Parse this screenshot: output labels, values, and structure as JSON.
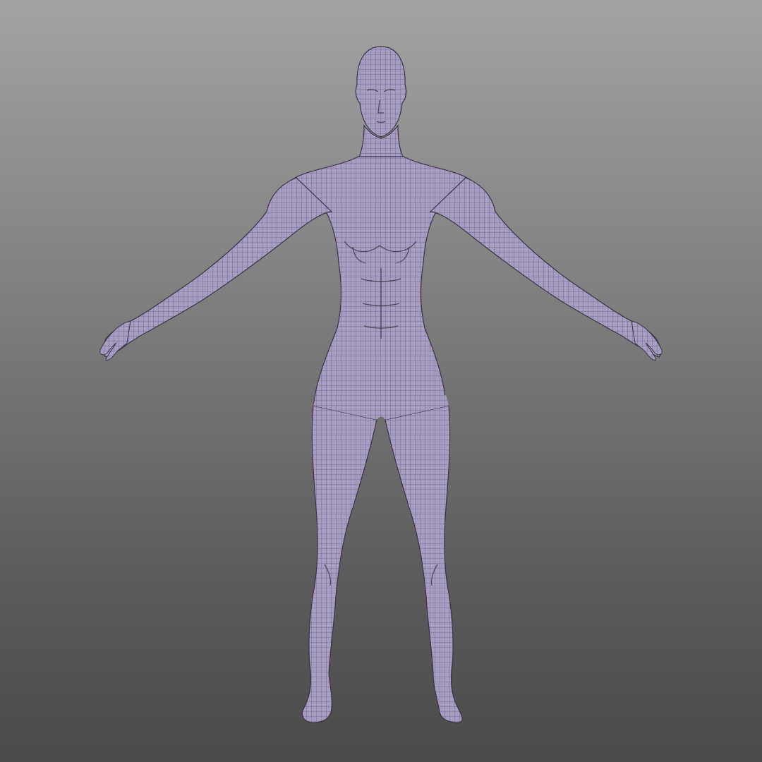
{
  "viewport": {
    "background_top": "#a3a3a3",
    "background_bottom": "#4a4a4a"
  },
  "model": {
    "description_icon": "human-body-wireframe-mesh-icon",
    "skin_color": "#a79bbf",
    "wire_color": "#2f2a3a",
    "pose": "A-pose"
  }
}
